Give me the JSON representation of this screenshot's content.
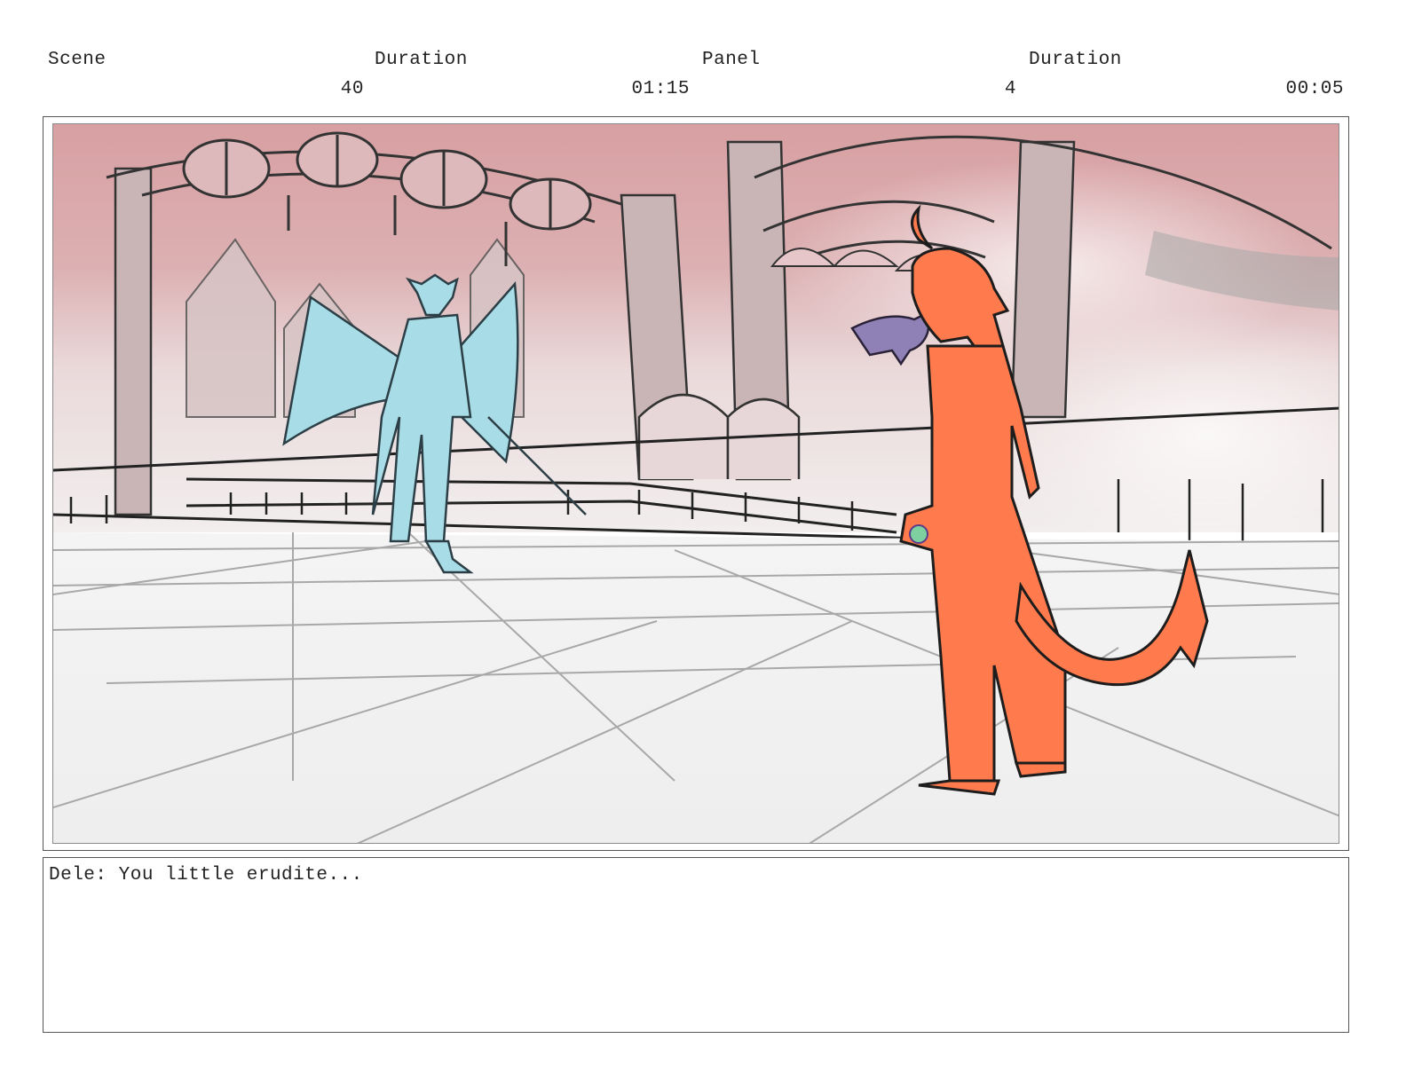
{
  "header": {
    "scene_label": "Scene",
    "scene_value": "40",
    "scene_duration_label": "Duration",
    "scene_duration_value": "01:15",
    "panel_label": "Panel",
    "panel_value": "4",
    "panel_duration_label": "Duration",
    "panel_duration_value": "00:05"
  },
  "panel": {
    "characters": [
      {
        "name_icon": "winged-demon-figure",
        "color": "#a8dce6"
      },
      {
        "name_icon": "horned-demon-figure",
        "color": "#ff7a4d"
      },
      {
        "name_icon": "small-creature-figure",
        "color": "#8f80b5"
      }
    ],
    "sky_color": "#d9a4a6",
    "floor_color": "#f1f1f1"
  },
  "dialogue": {
    "text": "Dele: You little erudite..."
  }
}
